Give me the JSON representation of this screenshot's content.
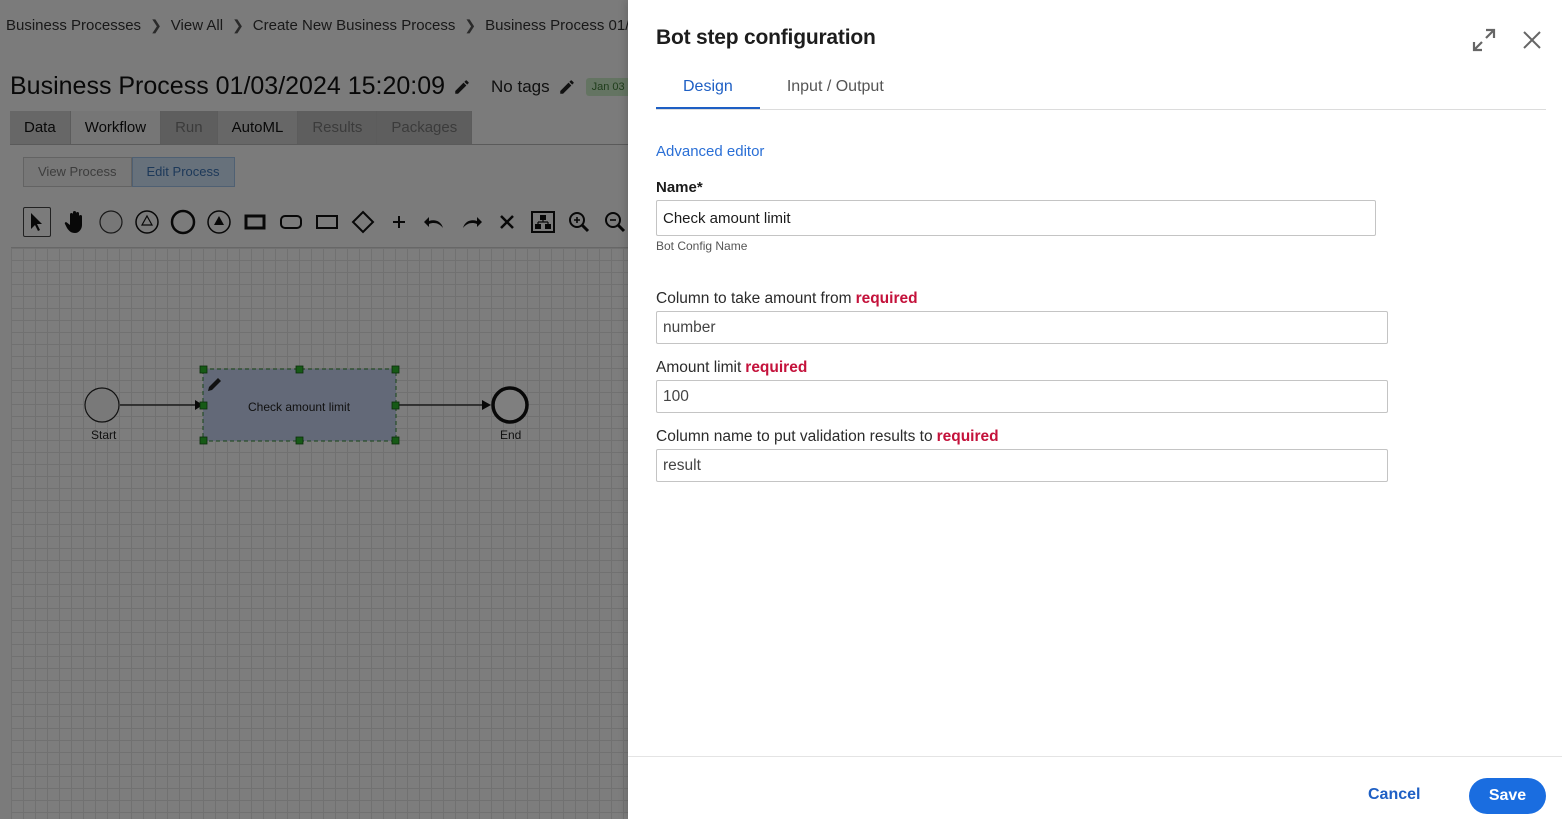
{
  "breadcrumb": {
    "items": [
      "Business Processes",
      "View All",
      "Create New Business Process",
      "Business Process 01/"
    ],
    "separator": ">"
  },
  "process": {
    "title": "Business Process 01/03/2024 15:20:09",
    "tags_label": "No tags",
    "date_badge": "Jan 03"
  },
  "app_tabs": [
    {
      "label": "Data",
      "state": "normal"
    },
    {
      "label": "Workflow",
      "state": "active"
    },
    {
      "label": "Run",
      "state": "disabled"
    },
    {
      "label": "AutoML",
      "state": "normal"
    },
    {
      "label": "Results",
      "state": "disabled"
    },
    {
      "label": "Packages",
      "state": "disabled"
    }
  ],
  "mode_buttons": {
    "view": "View Process",
    "edit": "Edit Process"
  },
  "toolbar_icons": [
    "pointer-icon",
    "hand-icon",
    "start-event-icon",
    "intermediate-event-icon",
    "end-event-icon",
    "filled-event-icon",
    "task-icon",
    "subprocess-icon",
    "rect-icon",
    "gateway-icon",
    "plus-icon",
    "undo-icon",
    "redo-icon",
    "delete-icon",
    "layout-icon",
    "zoom-in-icon",
    "zoom-out-icon"
  ],
  "diagram": {
    "start_label": "Start",
    "task_label": "Check amount limit",
    "end_label": "End"
  },
  "panel": {
    "title": "Bot step configuration",
    "tabs": [
      "Design",
      "Input / Output"
    ],
    "advanced_editor": "Advanced editor",
    "name_label": "Name*",
    "name_value": "Check amount limit",
    "name_hint": "Bot Config Name",
    "required_text": "required",
    "fields": [
      {
        "label": "Column to take amount from",
        "value": "number"
      },
      {
        "label": "Amount limit",
        "value": "100"
      },
      {
        "label": "Column name to put validation results to",
        "value": "result"
      }
    ],
    "cancel": "Cancel",
    "save": "Save"
  },
  "colors": {
    "accent": "#1a6de0",
    "required": "#c4123b"
  }
}
